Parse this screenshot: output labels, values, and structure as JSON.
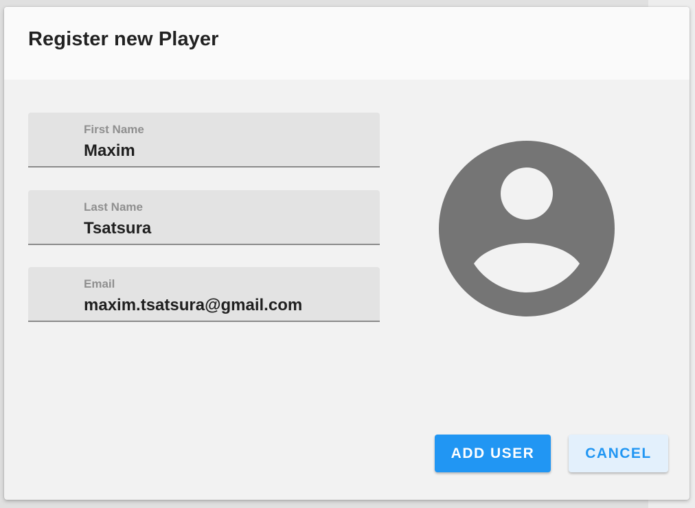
{
  "dialog": {
    "title": "Register new Player"
  },
  "form": {
    "first_name": {
      "label": "First Name",
      "value": "Maxim"
    },
    "last_name": {
      "label": "Last Name",
      "value": "Tsatsura"
    },
    "email": {
      "label": "Email",
      "value": "maxim.tsatsura@gmail.com"
    }
  },
  "avatar": {
    "icon": "account-circle-icon",
    "color": "#757575"
  },
  "actions": {
    "add_user_label": "ADD USER",
    "cancel_label": "CANCEL"
  },
  "colors": {
    "primary": "#2196f3",
    "secondary_bg": "#e3f0fc",
    "field_bg": "#e3e3e3"
  }
}
